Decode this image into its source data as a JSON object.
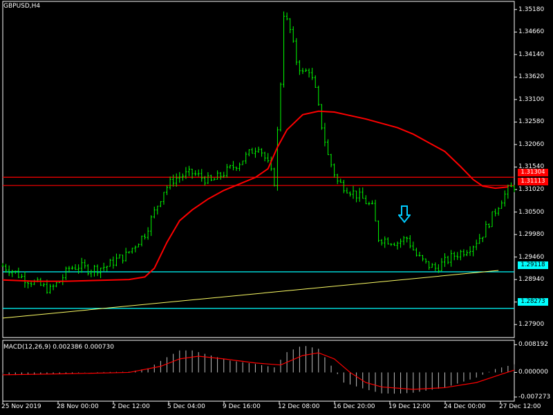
{
  "header": {
    "symbol_label": "GBPUSD,H4"
  },
  "macd": {
    "label": "MACD(12,26,9) 0.002386 0.000730",
    "ticks": [
      "0.008192",
      "0.000000",
      "-0.007273"
    ]
  },
  "price_axis": {
    "ticks": [
      "1.35180",
      "1.34660",
      "1.34140",
      "1.33620",
      "1.33100",
      "1.32580",
      "1.32060",
      "1.31540",
      "1.31020",
      "1.30500",
      "1.29980",
      "1.29460",
      "1.28940",
      "1.28420",
      "1.27900"
    ]
  },
  "time_axis": {
    "ticks": [
      "25 Nov 2019",
      "28 Nov 00:00",
      "2 Dec 12:00",
      "5 Dec 04:00",
      "9 Dec 16:00",
      "12 Dec 08:00",
      "16 Dec 20:00",
      "19 Dec 12:00",
      "24 Dec 00:00",
      "27 Dec 12:00"
    ]
  },
  "level_labels": {
    "red_upper": "1.31304",
    "red_lower": "1.31113",
    "cyan_upper": "1.29118",
    "cyan_lower": "1.28273"
  },
  "colors": {
    "background": "#000000",
    "candle": "#00ff00",
    "moving_average": "#ff0000",
    "resistance": "#ff0000",
    "support": "#00ffff",
    "trendline": "#ffff66",
    "macd_hist": "#c0c0c0",
    "macd_signal": "#ff0000",
    "arrow": "#00ccff"
  },
  "chart_data": {
    "type": "candlestick",
    "symbol": "GBPUSD",
    "timeframe": "H4",
    "ylim": [
      1.276,
      1.354
    ],
    "levels": [
      1.31304,
      1.31113,
      1.29118,
      1.28273
    ],
    "close_path": [
      [
        0,
        1.2925
      ],
      [
        3,
        1.2915
      ],
      [
        6,
        1.29
      ],
      [
        9,
        1.289
      ],
      [
        12,
        1.288
      ],
      [
        15,
        1.287
      ],
      [
        18,
        1.289
      ],
      [
        21,
        1.292
      ],
      [
        24,
        1.2925
      ],
      [
        27,
        1.2918
      ],
      [
        30,
        1.292
      ],
      [
        33,
        1.2925
      ],
      [
        36,
        1.294
      ],
      [
        39,
        1.295
      ],
      [
        42,
        1.2975
      ],
      [
        45,
        1.3
      ],
      [
        48,
        1.305
      ],
      [
        51,
        1.31
      ],
      [
        54,
        1.3125
      ],
      [
        57,
        1.3135
      ],
      [
        60,
        1.314
      ],
      [
        63,
        1.313
      ],
      [
        66,
        1.312
      ],
      [
        69,
        1.3135
      ],
      [
        72,
        1.315
      ],
      [
        75,
        1.3165
      ],
      [
        78,
        1.3185
      ],
      [
        81,
        1.3205
      ],
      [
        84,
        1.316
      ],
      [
        86,
        1.312
      ],
      [
        88,
        1.335
      ],
      [
        89,
        1.351
      ],
      [
        91,
        1.347
      ],
      [
        93,
        1.34
      ],
      [
        95,
        1.337
      ],
      [
        97,
        1.338
      ],
      [
        99,
        1.333
      ],
      [
        101,
        1.325
      ],
      [
        103,
        1.318
      ],
      [
        106,
        1.312
      ],
      [
        110,
        1.31
      ],
      [
        114,
        1.308
      ],
      [
        117,
        1.306
      ],
      [
        119,
        1.299
      ],
      [
        122,
        1.2985
      ],
      [
        125,
        1.298
      ],
      [
        128,
        1.299
      ],
      [
        131,
        1.295
      ],
      [
        134,
        1.293
      ],
      [
        137,
        1.292
      ],
      [
        140,
        1.2935
      ],
      [
        143,
        1.295
      ],
      [
        146,
        1.296
      ],
      [
        149,
        1.2975
      ],
      [
        152,
        1.3
      ],
      [
        155,
        1.304
      ],
      [
        158,
        1.308
      ],
      [
        160,
        1.31
      ],
      [
        162,
        1.311
      ]
    ],
    "moving_average": [
      [
        0,
        1.2893
      ],
      [
        10,
        1.289
      ],
      [
        20,
        1.289
      ],
      [
        30,
        1.2892
      ],
      [
        40,
        1.2894
      ],
      [
        45,
        1.29
      ],
      [
        48,
        1.292
      ],
      [
        52,
        1.298
      ],
      [
        56,
        1.303
      ],
      [
        60,
        1.3055
      ],
      [
        65,
        1.308
      ],
      [
        70,
        1.31
      ],
      [
        75,
        1.3115
      ],
      [
        80,
        1.313
      ],
      [
        84,
        1.315
      ],
      [
        87,
        1.32
      ],
      [
        90,
        1.324
      ],
      [
        95,
        1.3275
      ],
      [
        100,
        1.3283
      ],
      [
        105,
        1.3281
      ],
      [
        110,
        1.3273
      ],
      [
        115,
        1.3265
      ],
      [
        120,
        1.3255
      ],
      [
        125,
        1.3245
      ],
      [
        130,
        1.323
      ],
      [
        135,
        1.321
      ],
      [
        140,
        1.319
      ],
      [
        145,
        1.3155
      ],
      [
        149,
        1.3125
      ],
      [
        152,
        1.311
      ],
      [
        156,
        1.3105
      ],
      [
        160,
        1.3108
      ]
    ],
    "trendline": {
      "from": [
        0,
        1.2805
      ],
      "to": [
        157,
        1.2915
      ]
    },
    "macd": {
      "ylim": [
        -0.0085,
        0.0095
      ],
      "histogram_path": [
        [
          0,
          -0.0008
        ],
        [
          10,
          -0.0007
        ],
        [
          20,
          -0.0003
        ],
        [
          30,
          0.0001
        ],
        [
          40,
          0.0002
        ],
        [
          46,
          0.0012
        ],
        [
          52,
          0.0045
        ],
        [
          56,
          0.0065
        ],
        [
          60,
          0.0065
        ],
        [
          66,
          0.005
        ],
        [
          72,
          0.0035
        ],
        [
          80,
          0.0025
        ],
        [
          86,
          0.0015
        ],
        [
          90,
          0.006
        ],
        [
          95,
          0.008
        ],
        [
          100,
          0.007
        ],
        [
          104,
          0.002
        ],
        [
          108,
          -0.003
        ],
        [
          115,
          -0.005
        ],
        [
          120,
          -0.0062
        ],
        [
          125,
          -0.0063
        ],
        [
          130,
          -0.006
        ],
        [
          140,
          -0.0045
        ],
        [
          150,
          -0.0015
        ],
        [
          156,
          0.001
        ],
        [
          162,
          0.0024
        ]
      ],
      "signal_path": [
        [
          0,
          -0.0007
        ],
        [
          20,
          -0.0004
        ],
        [
          40,
          0.0
        ],
        [
          50,
          0.0018
        ],
        [
          56,
          0.004
        ],
        [
          62,
          0.0048
        ],
        [
          70,
          0.004
        ],
        [
          80,
          0.0028
        ],
        [
          88,
          0.0022
        ],
        [
          95,
          0.005
        ],
        [
          100,
          0.0058
        ],
        [
          105,
          0.004
        ],
        [
          110,
          0.0
        ],
        [
          115,
          -0.003
        ],
        [
          120,
          -0.0043
        ],
        [
          130,
          -0.005
        ],
        [
          140,
          -0.0045
        ],
        [
          150,
          -0.003
        ],
        [
          158,
          -0.0005
        ],
        [
          162,
          0.0007
        ]
      ]
    }
  }
}
